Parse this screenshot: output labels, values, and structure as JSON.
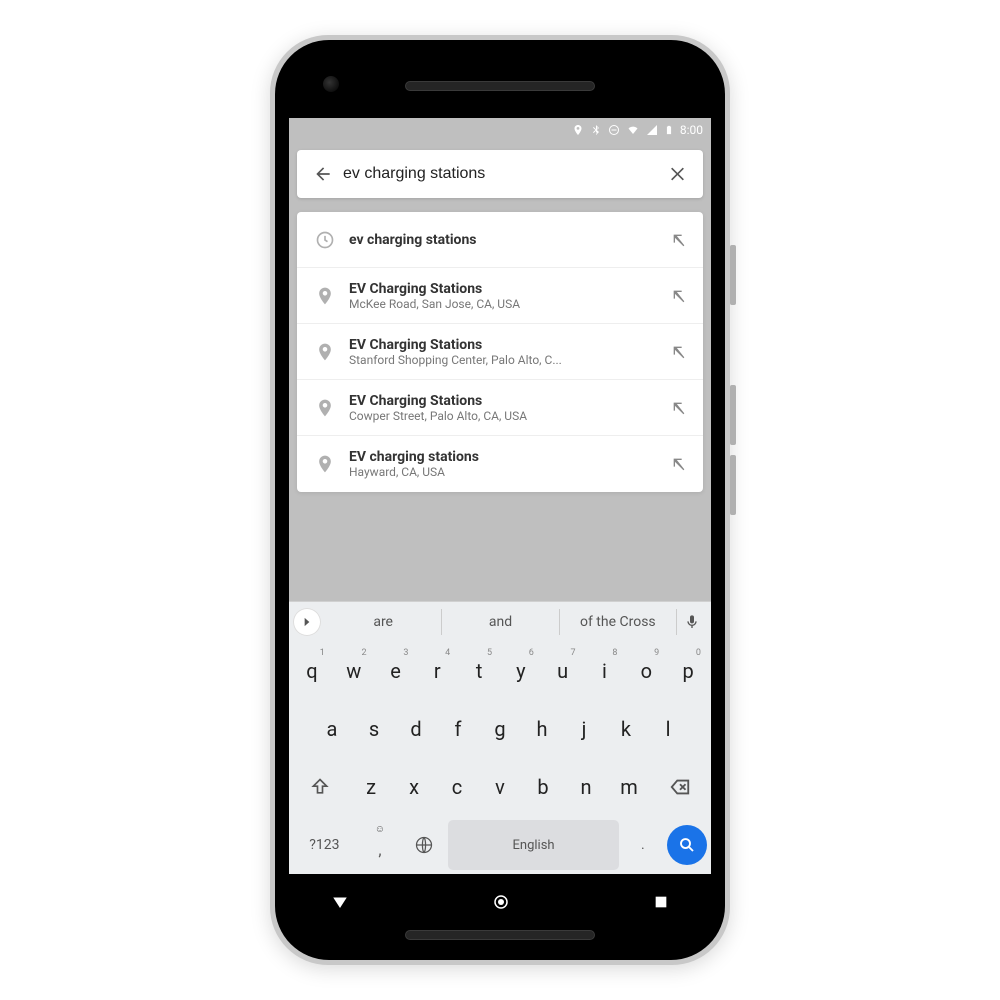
{
  "status": {
    "time": "8:00"
  },
  "search": {
    "value": "ev charging stations"
  },
  "suggestions": [
    {
      "type": "history",
      "title": "ev charging stations",
      "sub": ""
    },
    {
      "type": "place",
      "title": "EV Charging Stations",
      "sub": "McKee Road, San Jose, CA, USA"
    },
    {
      "type": "place",
      "title": "EV Charging Stations",
      "sub": "Stanford Shopping Center, Palo Alto, C..."
    },
    {
      "type": "place",
      "title": "EV Charging Stations",
      "sub": "Cowper Street, Palo Alto, CA, USA"
    },
    {
      "type": "place",
      "title": "EV charging stations",
      "sub": "Hayward, CA, USA"
    }
  ],
  "predict": {
    "w0": "are",
    "w1": "and",
    "w2": "of the Cross"
  },
  "keys": {
    "r1": [
      "q",
      "w",
      "e",
      "r",
      "t",
      "y",
      "u",
      "i",
      "o",
      "p"
    ],
    "n1": [
      "1",
      "2",
      "3",
      "4",
      "5",
      "6",
      "7",
      "8",
      "9",
      "0"
    ],
    "r2": [
      "a",
      "s",
      "d",
      "f",
      "g",
      "h",
      "j",
      "k",
      "l"
    ],
    "r3": [
      "z",
      "x",
      "c",
      "v",
      "b",
      "n",
      "m"
    ],
    "sym": "?123",
    "space": "English",
    "period": "."
  }
}
